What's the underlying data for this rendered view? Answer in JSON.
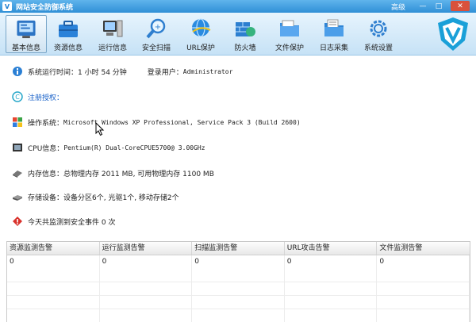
{
  "window": {
    "title": "网站安全防御系统",
    "level_label": "高级",
    "min_glyph": "—",
    "max_glyph": "□",
    "close_glyph": "✕"
  },
  "toolbar": {
    "items": [
      {
        "label": "基本信息",
        "icon": "basic-info-icon",
        "active": true
      },
      {
        "label": "资源信息",
        "icon": "briefcase-icon"
      },
      {
        "label": "运行信息",
        "icon": "computer-icon"
      },
      {
        "label": "安全扫描",
        "icon": "magnifier-icon"
      },
      {
        "label": "URL保护",
        "icon": "globe-shield-icon"
      },
      {
        "label": "防火墙",
        "icon": "firewall-icon"
      },
      {
        "label": "文件保护",
        "icon": "folder-icon"
      },
      {
        "label": "日志采集",
        "icon": "log-folder-icon"
      },
      {
        "label": "系统设置",
        "icon": "gear-icon"
      }
    ]
  },
  "info": {
    "runtime_label": "系统运行时间：",
    "runtime_value": "1 小时 54 分钟",
    "login_label": "登录用户：",
    "login_value": "Administrator",
    "register_label": "注册授权：",
    "os_label": "操作系统：",
    "os_value": "Microsoft Windows XP Professional, Service Pack 3 (Build 2600)",
    "cpu_label": "CPU信息：",
    "cpu_value": "Pentium(R) Dual-CoreCPUE5700@ 3.00GHz",
    "memory_label": "内存信息：",
    "memory_value": "总物理内存 2011 MB, 可用物理内存 1100 MB",
    "storage_label": "存储设备：",
    "storage_value": "设备分区6个, 光驱1个, 移动存储2个",
    "events_text": "今天共监测到安全事件 0 次"
  },
  "alarm_table": {
    "columns": [
      "资源监测告警",
      "运行监测告警",
      "扫描监测告警",
      "URL攻击告警",
      "文件监测告警"
    ],
    "rows": [
      [
        "0",
        "0",
        "0",
        "0",
        "0"
      ]
    ]
  },
  "colors": {
    "titlebar": "#2f8fd6",
    "toolbar_bg": "#d6ebf9",
    "link": "#1b63c9",
    "brand": "#1aa0d8"
  }
}
